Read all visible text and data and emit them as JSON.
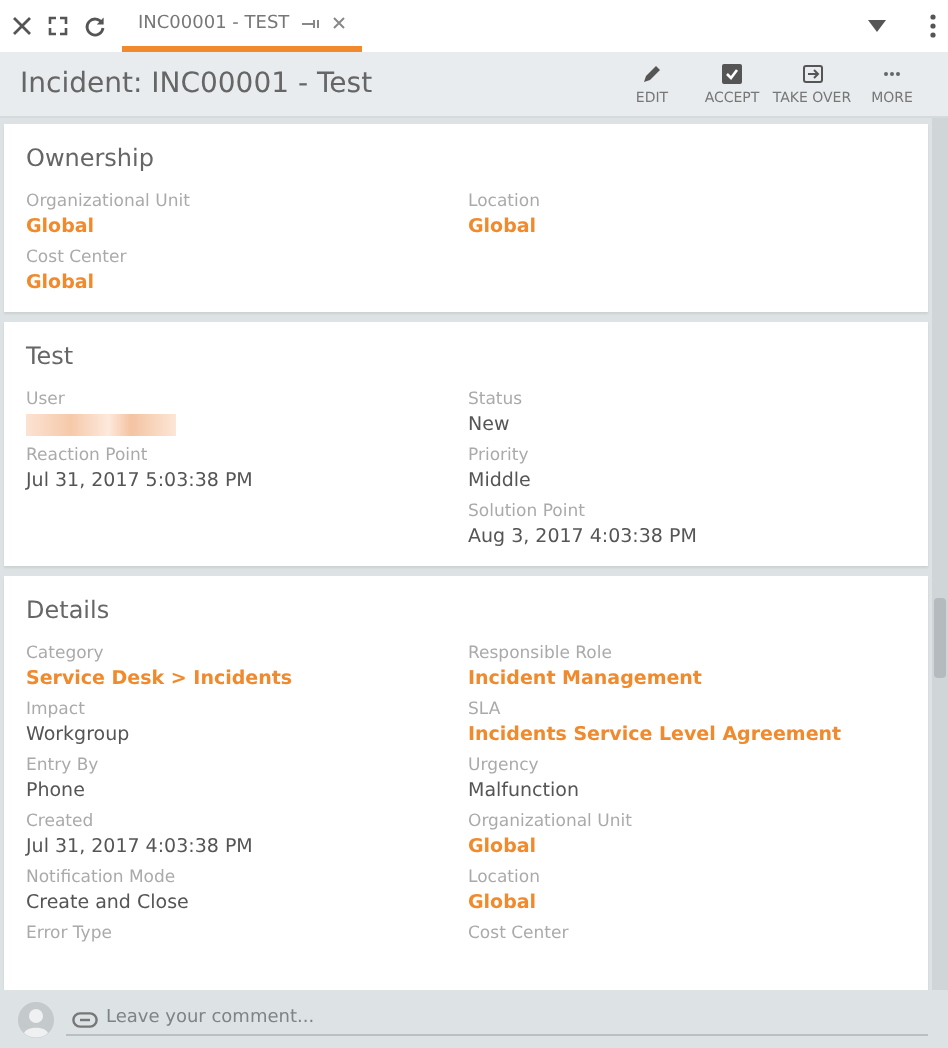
{
  "toolbar": {
    "tab": {
      "label": "INC00001 - TEST",
      "selected": true
    }
  },
  "header": {
    "title": "Incident: INC00001 - Test",
    "actions": [
      {
        "kind": "edit",
        "label": "EDIT"
      },
      {
        "kind": "accept",
        "label": "ACCEPT"
      },
      {
        "kind": "takeover",
        "label": "TAKE OVER"
      },
      {
        "kind": "more",
        "label": "MORE"
      }
    ]
  },
  "sections": [
    {
      "title": "Ownership",
      "left": [
        {
          "label": "Organizational Unit",
          "value": "Global",
          "link": true
        },
        {
          "label": "Cost Center",
          "value": "Global",
          "link": true
        }
      ],
      "right": [
        {
          "label": "Location",
          "value": "Global",
          "link": true
        }
      ]
    },
    {
      "title": "Test",
      "left": [
        {
          "label": "User",
          "redacted": true
        },
        {
          "label": "Reaction Point",
          "value": "Jul 31, 2017 5:03:38 PM",
          "link": false
        }
      ],
      "right": [
        {
          "label": "Status",
          "value": "New",
          "link": false
        },
        {
          "label": "Priority",
          "value": "Middle",
          "link": false
        },
        {
          "label": "Solution Point",
          "value": "Aug 3, 2017 4:03:38 PM",
          "link": false
        }
      ]
    },
    {
      "title": "Details",
      "left": [
        {
          "label": "Category",
          "value": "Service Desk > Incidents",
          "link": true
        },
        {
          "label": "Impact",
          "value": "Workgroup",
          "link": false
        },
        {
          "label": "Entry By",
          "value": "Phone",
          "link": false
        },
        {
          "label": "Created",
          "value": "Jul 31, 2017 4:03:38 PM",
          "link": false
        },
        {
          "label": "Notification Mode",
          "value": "Create and Close",
          "link": false
        },
        {
          "label": "Error Type"
        }
      ],
      "right": [
        {
          "label": "Responsible Role",
          "value": "Incident Management",
          "link": true
        },
        {
          "label": "SLA",
          "value": "Incidents Service Level Agreement",
          "link": true
        },
        {
          "label": "Urgency",
          "value": "Malfunction",
          "link": false
        },
        {
          "label": "Organizational Unit",
          "value": "Global",
          "link": true
        },
        {
          "label": "Location",
          "value": "Global",
          "link": true
        },
        {
          "label": "Cost Center"
        }
      ]
    }
  ],
  "comment": {
    "placeholder": "Leave your comment..."
  }
}
